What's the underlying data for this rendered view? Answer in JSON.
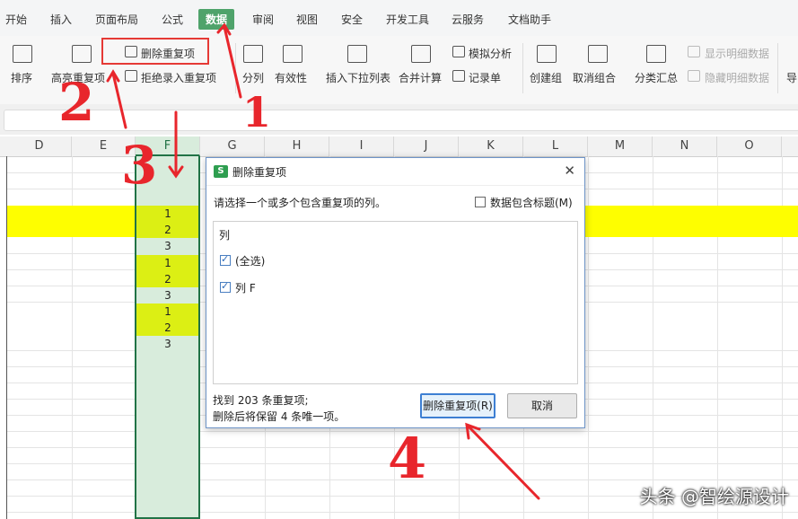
{
  "ribbon_tabs": [
    "开始",
    "插入",
    "页面布局",
    "公式",
    "数据",
    "审阅",
    "视图",
    "安全",
    "开发工具",
    "云服务",
    "文档助手"
  ],
  "active_tab": "数据",
  "ribbon": {
    "sort": "排序",
    "highlight_dup": "高亮重复项",
    "remove_dup": "删除重复项",
    "reject_dup": "拒绝录入重复项",
    "split_col": "分列",
    "validity": "有效性",
    "insert_dropdown": "插入下拉列表",
    "merge_calc": "合并计算",
    "whatif": "模拟分析",
    "record_sheet": "记录单",
    "create_group": "创建组",
    "ungroup": "取消组合",
    "subtotal": "分类汇总",
    "show_detail": "显示明细数据",
    "hide_detail": "隐藏明细数据",
    "import": "导"
  },
  "columns": [
    "D",
    "E",
    "F",
    "G",
    "H",
    "I",
    "J",
    "K",
    "L",
    "M",
    "N",
    "O"
  ],
  "selected_column": "F",
  "cells_F": [
    "1",
    "2",
    "3",
    "1",
    "2",
    "3",
    "1",
    "2",
    "3"
  ],
  "dialog": {
    "title": "删除重复项",
    "logo": "S",
    "close": "✕",
    "prompt": "请选择一个或多个包含重复项的列。",
    "header_checkbox_label": "数据包含标题(M)",
    "list_header": "列",
    "items": [
      "(全选)",
      "列 F"
    ],
    "found_text": "找到 203 条重复项;",
    "keep_text": "删除后将保留 4 条唯一项。",
    "ok_button": "删除重复项(R)",
    "cancel_button": "取消"
  },
  "annotations": [
    "1",
    "2",
    "3",
    "4"
  ],
  "watermark": "头条 @智绘源设计",
  "colors": {
    "accent_green": "#217346",
    "tab_active": "#4fa36b",
    "highlight_yellow": "#fefe00",
    "highlight_lime": "#dcef14",
    "annotation_red": "#e8262c"
  }
}
